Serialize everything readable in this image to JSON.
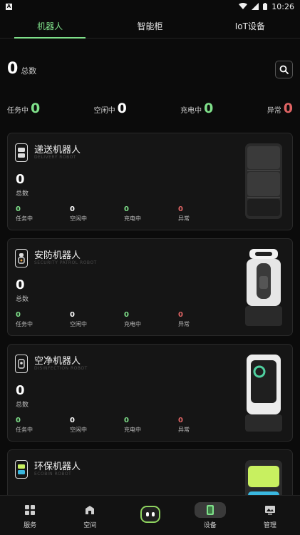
{
  "status_bar": {
    "time": "10:26",
    "left_glyph": "A"
  },
  "tabs": [
    {
      "label": "机器人",
      "active": true
    },
    {
      "label": "智能柜",
      "active": false
    },
    {
      "label": "IoT设备",
      "active": false
    }
  ],
  "summary": {
    "total": "0",
    "total_label": "总数",
    "stats": [
      {
        "label": "任务中",
        "value": "0",
        "color": "#7fe08a"
      },
      {
        "label": "空闲中",
        "value": "0",
        "color": "#ffffff"
      },
      {
        "label": "充电中",
        "value": "0",
        "color": "#7fe08a"
      },
      {
        "label": "异常",
        "value": "0",
        "color": "#e06464"
      }
    ]
  },
  "cards": [
    {
      "title": "递送机器人",
      "subtitle": "DELIVERY ROBOT",
      "count": "0",
      "count_label": "总数",
      "icon": "delivery-robot-icon",
      "image": "delivery-robot-image",
      "stats": [
        {
          "label": "任务中",
          "value": "0"
        },
        {
          "label": "空闲中",
          "value": "0"
        },
        {
          "label": "充电中",
          "value": "0"
        },
        {
          "label": "异常",
          "value": "0"
        }
      ]
    },
    {
      "title": "安防机器人",
      "subtitle": "SECURITY PATROL ROBOT",
      "count": "0",
      "count_label": "总数",
      "icon": "security-robot-icon",
      "image": "security-robot-image",
      "stats": [
        {
          "label": "任务中",
          "value": "0"
        },
        {
          "label": "空闲中",
          "value": "0"
        },
        {
          "label": "充电中",
          "value": "0"
        },
        {
          "label": "异常",
          "value": "0"
        }
      ]
    },
    {
      "title": "空净机器人",
      "subtitle": "DISINFECTION ROBOT",
      "count": "0",
      "count_label": "总数",
      "icon": "disinfection-robot-icon",
      "image": "disinfection-robot-image",
      "stats": [
        {
          "label": "任务中",
          "value": "0"
        },
        {
          "label": "空闲中",
          "value": "0"
        },
        {
          "label": "充电中",
          "value": "0"
        },
        {
          "label": "异常",
          "value": "0"
        }
      ]
    },
    {
      "title": "环保机器人",
      "subtitle": "ECOBIN ROBOT",
      "icon": "ecobin-robot-icon",
      "image": "ecobin-robot-image"
    }
  ],
  "bottom_nav": [
    {
      "label": "服务",
      "icon": "grid-icon"
    },
    {
      "label": "空间",
      "icon": "building-icon"
    },
    {
      "label": "",
      "icon": "robot-face-icon"
    },
    {
      "label": "设备",
      "icon": "device-icon"
    },
    {
      "label": "管理",
      "icon": "monitor-icon"
    }
  ],
  "colors": {
    "accent": "#7fe08a",
    "error": "#e06464",
    "background": "#0b0b0b",
    "card": "#151515"
  }
}
